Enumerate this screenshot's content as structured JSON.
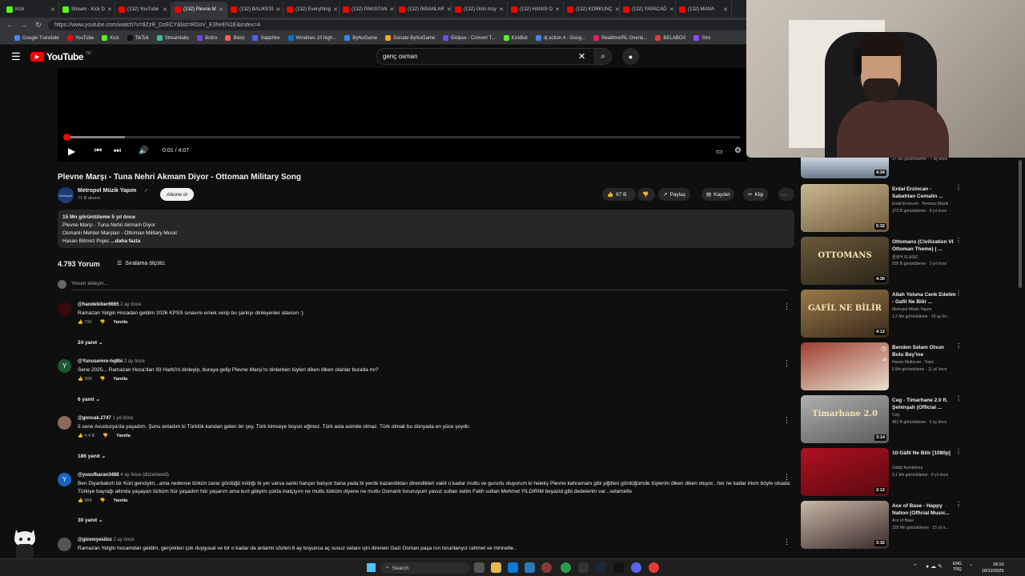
{
  "browser": {
    "tabs": [
      {
        "label": "Kick",
        "color": "#53fc18",
        "active": false
      },
      {
        "label": "Stream - Kick D",
        "color": "#53fc18",
        "active": false
      },
      {
        "label": "(132) YouTube",
        "color": "#ff0000",
        "active": false
      },
      {
        "label": "(132) Plevne M",
        "color": "#ff0000",
        "active": true
      },
      {
        "label": "(132) BALIKESİ",
        "color": "#ff0000",
        "active": false
      },
      {
        "label": "(132) Everything",
        "color": "#ff0000",
        "active": false
      },
      {
        "label": "(132) PAKISTAN",
        "color": "#ff0000",
        "active": false
      },
      {
        "label": "(132) İNSANLAR",
        "color": "#ff0000",
        "active": false
      },
      {
        "label": "(132) Ünlü müy",
        "color": "#ff0000",
        "active": false
      },
      {
        "label": "(132) HANGİ O",
        "color": "#ff0000",
        "active": false
      },
      {
        "label": "(132) KORKUNÇ",
        "color": "#ff0000",
        "active": false
      },
      {
        "label": "(132) YAPACAĞ",
        "color": "#ff0000",
        "active": false
      },
      {
        "label": "(132) MANA",
        "color": "#ff0000",
        "active": false
      }
    ],
    "url": "https://www.youtube.com/watch?v=9ZzR_DzECY&list=RDoV_E3heEN1E&index=4",
    "bookmarks": [
      {
        "label": "Google Translate",
        "color": "#4285f4"
      },
      {
        "label": "YouTube",
        "color": "#ff0000"
      },
      {
        "label": "Kick",
        "color": "#53fc18"
      },
      {
        "label": "TikTok",
        "color": "#111111"
      },
      {
        "label": "Streamlabs",
        "color": "#31c3a2"
      },
      {
        "label": "Botrix",
        "color": "#7b3fe4"
      },
      {
        "label": "Blerp",
        "color": "#ff5a5a"
      },
      {
        "label": "Sapphire",
        "color": "#3a6ff7"
      },
      {
        "label": "Windows 10 high...",
        "color": "#0078d4"
      },
      {
        "label": "ByNoGame",
        "color": "#2d8cff"
      },
      {
        "label": "Donate ByNoGame",
        "color": "#f5a623"
      },
      {
        "label": "Eklipse - Convert T...",
        "color": "#6b4cff"
      },
      {
        "label": "KickBot",
        "color": "#53fc18"
      },
      {
        "label": "dj action 4 - Goog...",
        "color": "#4285f4"
      },
      {
        "label": "RealtimeIRL Overla...",
        "color": "#e91e63"
      },
      {
        "label": "BELABOX",
        "color": "#e53935"
      },
      {
        "label": "Stre",
        "color": "#9146ff"
      }
    ]
  },
  "youtube": {
    "logo_text": "YouTube",
    "logo_country": "TR",
    "search_query": "genç osman",
    "icons": {
      "menu": "☰",
      "clear": "✕",
      "search": "⌕",
      "mic": "🎤"
    }
  },
  "player": {
    "progress": 0.004,
    "buffered": 0.09,
    "time_current": "0:01",
    "time_total": "4:07",
    "time_display": "0:01 / 4:07"
  },
  "video": {
    "title": "Plevne Marşı - Tuna Nehri Akmam Diyor - Ottoman Military Song",
    "channel_name": "Metropol Müzik Yapım",
    "channel_subs": "71 B abone",
    "avatar_text": "Metropol",
    "subscribe_label": "Abone ol",
    "like_count": "87 B",
    "share_label": "Paylaş",
    "save_label": "Kaydet",
    "clip_label": "Klip",
    "more_label": "···"
  },
  "description": {
    "stats": "15 Mn görüntüleme  5 yıl önce",
    "lines": [
      "Plevne Marşı - Tuna Nehri Akmam Diyor",
      "Osmanlı Mehter Marşları - Ottoman Military Music"
    ],
    "last_line": "Hasan Bitmez Pojec",
    "more_label": "...daha fazla"
  },
  "comments": {
    "count": "4.793 Yorum",
    "sort_label": "Sıralama ölçütü:",
    "add_placeholder": "Yorum ekleyin...",
    "reply_label": "Yanıtla",
    "items": [
      {
        "user": "@handebiber6665",
        "time": "2 ay önce",
        "text": "Ramazan Yetgin Hocadan geldim 2026 KPSS sınavını emek verip  bu şarkıyı dinleyenler atansın :)",
        "likes": "792",
        "replies": "24 yanıt",
        "avatar": "",
        "avatar_color": "#3a0a0a"
      },
      {
        "user": "@Yunusemre-hq8bi",
        "time": "2 ay önce",
        "text": "Sene 2025... Ramazan Hoca'dan 93 Harbi'ni dinleyip, buraya gelip Plevne Marşı'nı dinlerken tüyleri diken diken olanlar burada mı?",
        "likes": "309",
        "replies": "6 yanıt",
        "avatar": "Y",
        "avatar_color": "#1e5631"
      },
      {
        "user": "@goncak.2747",
        "time": "1 yıl önce",
        "text": "5 sene Avusturya'da yaşadım. Şunu anladım ki Türklük kandan gelen bir şey. Türk kimseye boyun eğmez. Türk asla asimile olmaz. Türk olmak  bu dünyada en yüce şeydir.",
        "likes": "4,4 B",
        "replies": "186 yanıt",
        "avatar": "",
        "avatar_color": "#8a6a5a"
      },
      {
        "user": "@yusufbaran3488",
        "time": "4 ay önce (düzenlendi)",
        "text": "Ben Diyarbakırlı bir Kürt genciyim...ama nedense türkün zarar gördüğü kıldığı bi yer varsa sanki hançer batıyor bana yada bi yerde kazandıkları direndikleri vakit o kadar mutlu ve gururlu oluyorum ki helekş Plevne kahramanı gibi yiğitleri gördüğümde tüylerim diken diken oluyor...her ne kadar irkım böyle olsada Türkiye bayrağı altında yaşayan türküm hür yaşadım hür yaşarım ama kurt gibiyim çokta inatçıyım ne mutlu türküm diyene ne mutlu Osmanlı torunuyum yavuz sultan selim Fatih sultan Mehmet YILDIRIM  beyazid gibi dedelerim var...selametle",
        "likes": "364",
        "replies": "30 yanıt",
        "avatar": "Y",
        "avatar_color": "#1565c0"
      },
      {
        "user": "@gizemyesiloz",
        "time": "2 ay önce",
        "text": "Ramazan Yetgin hocamdan geldim, gerçekten çok duygusal ve bir o kadar da anlamlı sözleri.6 ay boyunca aç susuz vatanı için direnen Gazi Osman paşa nın  torunlarıyız rahmet ve minnetle..",
        "likes": "",
        "replies": "",
        "avatar": "",
        "avatar_color": "#555555"
      }
    ]
  },
  "sidebar": {
    "top_meta": "37 Mn görüntüleme · 7 ay önce",
    "top_duration": "4:34",
    "items": [
      {
        "title": "Erdal Erzincan - Sabahtan Cemalin ...",
        "channel": "Erdal Erzincan - Temmuz Müzik",
        "meta": "272 B görüntüleme · 5 yıl önce",
        "duration": "5:32",
        "thumb_text": "",
        "color1": "#6e5a3a",
        "color2": "#c8b890"
      },
      {
        "title": "Ottomans (Civilization VI Ottoman Theme) | ...",
        "channel": "클래식 FLASIC",
        "meta": "505 B görüntüleme · 2 yıl önce",
        "duration": "4:30",
        "thumb_text": "OTTOMANS",
        "color1": "#2a2418",
        "color2": "#6b5a3a"
      },
      {
        "title": "Allah Yoluna Cenk Edelim - Gafil Ne Bilir ...",
        "channel": "Metropol Müzik Yapım",
        "meta": "1,2 Mn görüntüleme · 10 ay ön...",
        "duration": "4:12",
        "thumb_text": "GAFİL NE BİLİR",
        "color1": "#3a2a1a",
        "color2": "#9a7a4a"
      },
      {
        "title": "Benden Selam Olsun Bolu Bey'ine",
        "channel": "Hasan Mutlucan - Topic",
        "meta": "6 Mn görüntüleme · 11 yıl önce",
        "duration": "",
        "thumb_text": "",
        "color1": "#e8e0d0",
        "color2": "#a04030"
      },
      {
        "title": "Ceg - Timarhane 2.0 ft. Şehinşah (Official ...",
        "channel": "Ceg",
        "meta": "451 B görüntüleme · 5 ay önce",
        "duration": "3:14",
        "thumb_text": "Timarhane 2.0",
        "color1": "#5a5a5a",
        "color2": "#b0b0b0"
      },
      {
        "title": "10-Gâfil Ne Bilir [1080p]",
        "channel": "Üstâd Kemânkeş",
        "meta": "3,1 Mn görüntüleme · 9 yıl önce",
        "duration": "2:12",
        "thumb_text": "",
        "color1": "#5a0a10",
        "color2": "#b01020"
      },
      {
        "title": "Ace of Base - Happy Nation (Official Music...",
        "channel": "Ace of Base",
        "meta": "229 Mn görüntüleme · 15 yıl ö...",
        "duration": "3:32",
        "thumb_text": "",
        "color1": "#3a2a28",
        "color2": "#c8b8a8"
      }
    ]
  },
  "taskbar": {
    "search_label": "Search",
    "lang_line1": "ENG",
    "lang_line2": "TRQ",
    "clock_time": "18:10",
    "clock_date": "18/12/2025"
  },
  "colors": {
    "accent": "#ff0000",
    "bg": "#0f0f0f"
  }
}
